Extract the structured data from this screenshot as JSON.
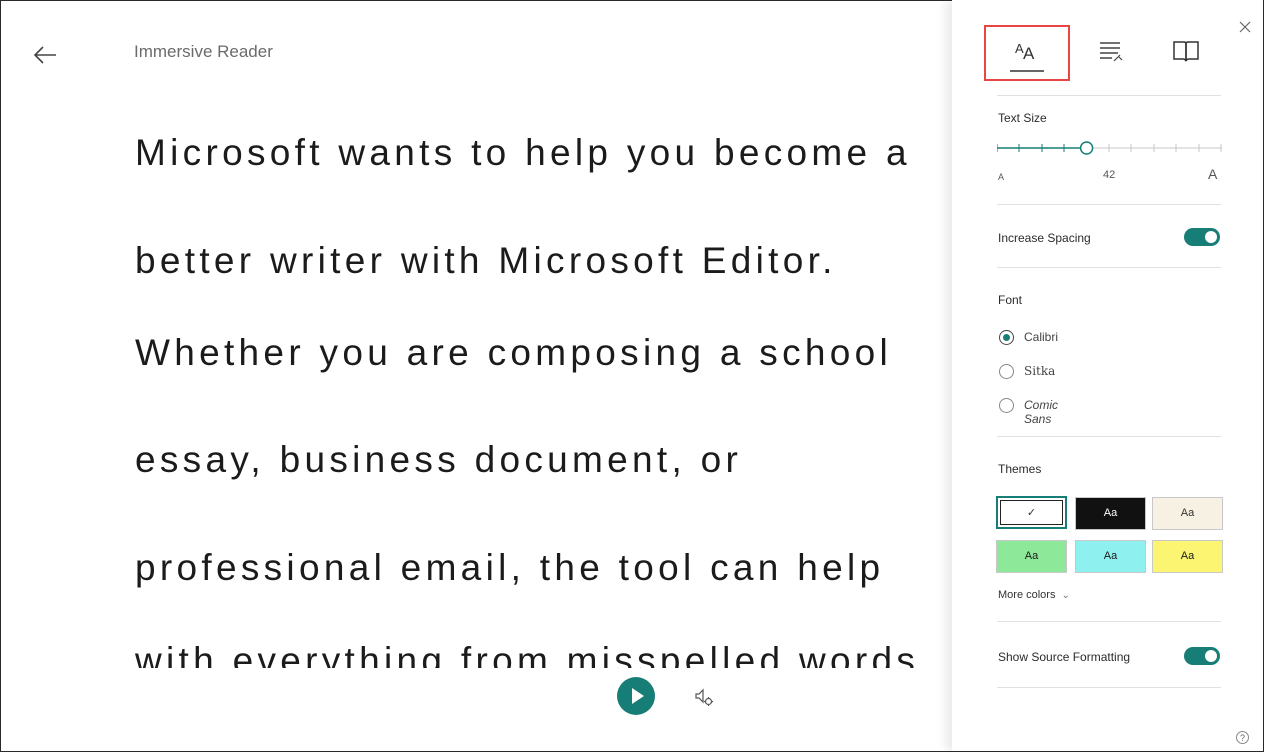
{
  "header": {
    "title": "Immersive Reader"
  },
  "reader": {
    "lines": [
      "Microsoft wants to help you become a",
      "better writer with Microsoft Editor.",
      "Whether you are composing a school",
      "essay, business document, or",
      "professional email, the tool can help",
      "with everything from misspelled words"
    ]
  },
  "panel": {
    "text_size": {
      "label": "Text Size",
      "small_label": "A",
      "value": "42",
      "large_label": "A",
      "level": 0.4
    },
    "increase_spacing": {
      "label": "Increase Spacing",
      "on": true
    },
    "font": {
      "label": "Font",
      "options": [
        "Calibri",
        "Sitka",
        "Comic Sans"
      ],
      "selected": "Calibri"
    },
    "themes": {
      "label": "Themes",
      "swatches": [
        {
          "label": "✓",
          "bg": "#ffffff",
          "fg": "#333333",
          "selected": true
        },
        {
          "label": "Aa",
          "bg": "#111111",
          "fg": "#ffffff"
        },
        {
          "label": "Aa",
          "bg": "#f6f1e3",
          "fg": "#333333"
        },
        {
          "label": "Aa",
          "bg": "#8de89a",
          "fg": "#1b1b1b"
        },
        {
          "label": "Aa",
          "bg": "#8ef1ef",
          "fg": "#1b1b1b"
        },
        {
          "label": "Aa",
          "bg": "#fbf571",
          "fg": "#1b1b1b"
        }
      ],
      "more_colors": "More colors"
    },
    "show_source_formatting": {
      "label": "Show Source Formatting",
      "on": true
    },
    "help": "?"
  },
  "colors": {
    "accent": "#177e77",
    "highlight_border": "#e84545"
  },
  "icons": [
    "back-arrow-icon",
    "play-icon",
    "voice-settings-icon",
    "text-preferences-icon",
    "grammar-options-icon",
    "reading-preferences-icon",
    "close-icon",
    "help-icon",
    "chevron-down-icon"
  ]
}
